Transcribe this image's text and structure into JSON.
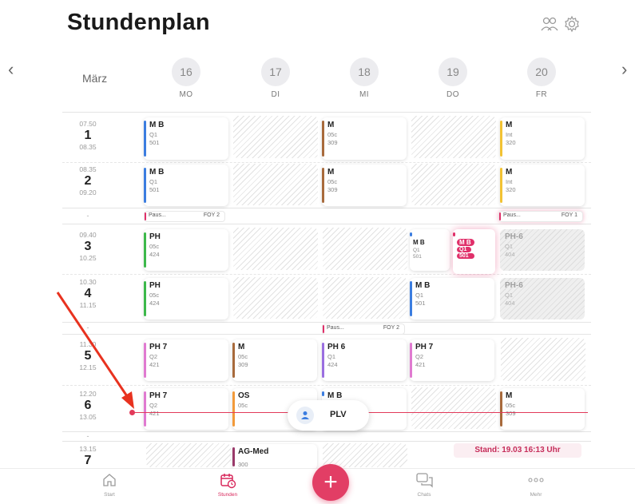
{
  "header": {
    "title": "Stundenplan",
    "icons": [
      "users-icon",
      "gear-icon"
    ]
  },
  "nav": {
    "prev": "‹",
    "next": "›",
    "month": "März"
  },
  "days": [
    {
      "num": "16",
      "name": "MO"
    },
    {
      "num": "17",
      "name": "DI"
    },
    {
      "num": "18",
      "name": "MI"
    },
    {
      "num": "19",
      "name": "DO"
    },
    {
      "num": "20",
      "name": "FR"
    }
  ],
  "periods": [
    {
      "start": "07.50",
      "num": "1",
      "end": "08.35"
    },
    {
      "start": "08.35",
      "num": "2",
      "end": "09.20"
    },
    {
      "start": "09.40",
      "num": "3",
      "end": "10.25"
    },
    {
      "start": "10.30",
      "num": "4",
      "end": "11.15"
    },
    {
      "start": "11.30",
      "num": "5",
      "end": "12.15"
    },
    {
      "start": "12.20",
      "num": "6",
      "end": "13.05"
    },
    {
      "start": "13.15",
      "num": "7",
      "end": ""
    }
  ],
  "separators": [
    "-",
    "-",
    "-"
  ],
  "lessons": {
    "p1_mo": {
      "subject": "M B",
      "course": "Q1",
      "room": "501",
      "color": "#3b7de0"
    },
    "p1_mi": {
      "subject": "M",
      "course": "05c",
      "room": "309",
      "color": "#a86a3c"
    },
    "p1_fr": {
      "subject": "M",
      "course": "Int",
      "room": "320",
      "color": "#f2c233"
    },
    "p2_mo": {
      "subject": "M B",
      "course": "Q1",
      "room": "501",
      "color": "#3b7de0"
    },
    "p2_mi": {
      "subject": "M",
      "course": "05c",
      "room": "309",
      "color": "#a86a3c"
    },
    "p2_fr": {
      "subject": "M",
      "course": "Int",
      "room": "320",
      "color": "#f2c233"
    },
    "p3_mo": {
      "subject": "PH",
      "course": "05c",
      "room": "424",
      "color": "#3cb84a"
    },
    "p3_do_a": {
      "subject": "M B",
      "course": "Q1",
      "room": "501",
      "color": "#3b7de0"
    },
    "p3_do_b": {
      "subject": "M B",
      "course": "Q1",
      "room": "501",
      "color": "#e0306a"
    },
    "p3_fr": {
      "subject": "PH-6",
      "course": "Q1",
      "room": "404",
      "color": "#bbbbbb"
    },
    "p4_mo": {
      "subject": "PH",
      "course": "05c",
      "room": "424",
      "color": "#3cb84a"
    },
    "p4_do": {
      "subject": "M B",
      "course": "Q1",
      "room": "501",
      "color": "#3b7de0"
    },
    "p4_fr": {
      "subject": "PH-6",
      "course": "Q1",
      "room": "404",
      "color": "#bbbbbb"
    },
    "p5_mo": {
      "subject": "PH 7",
      "course": "Q2",
      "room": "421",
      "color": "#e07ad0"
    },
    "p5_di": {
      "subject": "M",
      "course": "05c",
      "room": "309",
      "color": "#a86a3c"
    },
    "p5_mi": {
      "subject": "PH 6",
      "course": "Q1",
      "room": "424",
      "color": "#9a6ee0"
    },
    "p5_do": {
      "subject": "PH 7",
      "course": "Q2",
      "room": "421",
      "color": "#e07ad0"
    },
    "p6_mo": {
      "subject": "PH 7",
      "course": "Q2",
      "room": "421",
      "color": "#e07ad0"
    },
    "p6_di": {
      "subject": "OS",
      "course": "05c",
      "room": "",
      "color": "#f29a3a"
    },
    "p6_mi": {
      "subject": "M B",
      "course": "",
      "room": "",
      "color": "#3b7de0"
    },
    "p6_fr": {
      "subject": "M",
      "course": "05c",
      "room": "309",
      "color": "#a86a3c"
    },
    "p7_di": {
      "subject": "AG-Med",
      "course": "",
      "room": "300",
      "color": "#9a3a6a"
    }
  },
  "pauses": {
    "mo": {
      "label": "Paus...",
      "room": "FOY 2"
    },
    "fr": {
      "label": "Paus...",
      "room": "FOY 1"
    },
    "mi": {
      "label": "Paus...",
      "room": "FOY 2"
    }
  },
  "floating": {
    "plv_label": "PLV",
    "stand": "Stand: 19.03 16:13 Uhr"
  },
  "tabs": [
    {
      "label": "Start",
      "icon": "home-icon"
    },
    {
      "label": "Stunden",
      "icon": "calendar-clock-icon"
    },
    {
      "label": "Chats",
      "icon": "chat-icon"
    },
    {
      "label": "Mehr",
      "icon": "more-icon"
    }
  ],
  "fab": {
    "label": "+"
  },
  "colors": {
    "accent": "#e23e65",
    "now_line": "#e23a5a",
    "annotation_arrow": "#e8321f"
  }
}
